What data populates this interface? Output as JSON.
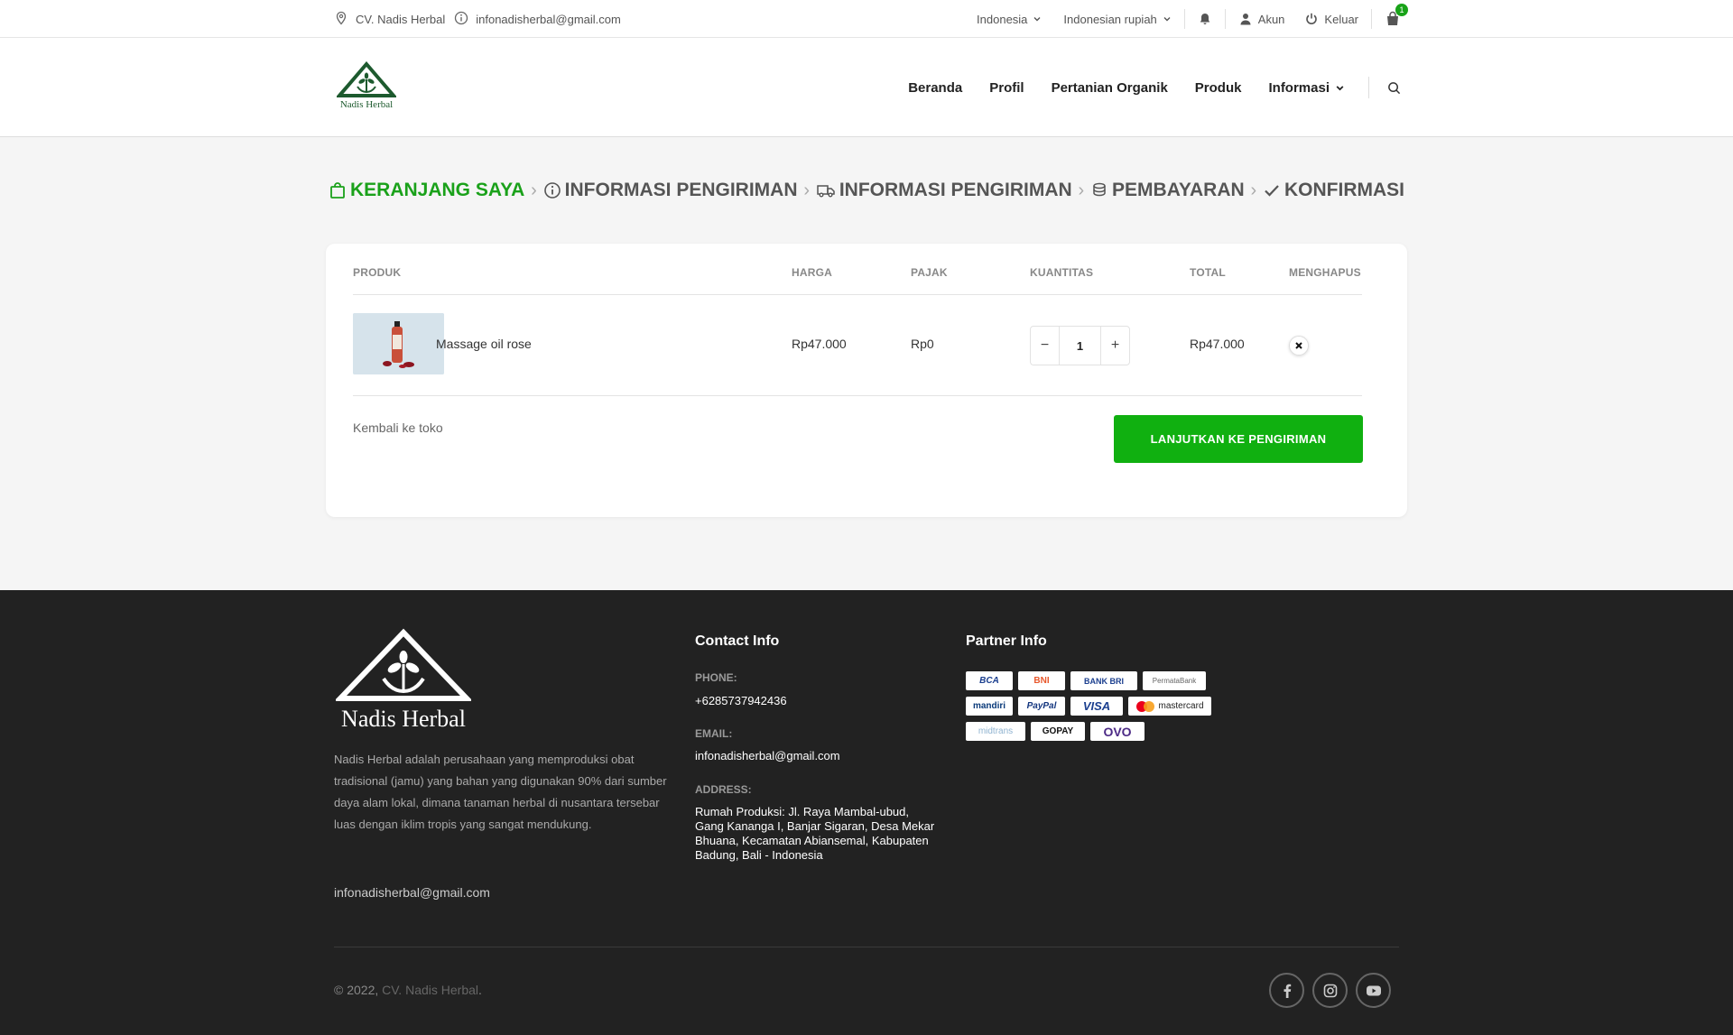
{
  "topbar": {
    "company": "CV. Nadis Herbal",
    "email": "infonadisherbal@gmail.com",
    "language": "Indonesia",
    "currency": "Indonesian rupiah",
    "account": "Akun",
    "logout": "Keluar",
    "cart_count": "1"
  },
  "header": {
    "logo_text": "Nadis Herbal",
    "nav": [
      "Beranda",
      "Profil",
      "Pertanian Organik",
      "Produk",
      "Informasi"
    ]
  },
  "steps": [
    "KERANJANG SAYA",
    "INFORMASI PENGIRIMAN",
    "INFORMASI PENGIRIMAN",
    "PEMBAYARAN",
    "KONFIRMASI"
  ],
  "cart": {
    "headers": {
      "product": "PRODUK",
      "price": "HARGA",
      "tax": "PAJAK",
      "quantity": "KUANTITAS",
      "total": "TOTAL",
      "remove": "MENGHAPUS"
    },
    "items": [
      {
        "name": "Massage oil rose",
        "price": "Rp47.000",
        "tax": "Rp0",
        "qty": "1",
        "total": "Rp47.000"
      }
    ],
    "back_link": "Kembali ke toko",
    "next_button": "LANJUTKAN KE PENGIRIMAN"
  },
  "footer": {
    "logo_text": "Nadis Herbal",
    "about": "Nadis Herbal adalah perusahaan yang memproduksi obat tradisional (jamu) yang bahan yang digunakan 90% dari sumber daya alam lokal, dimana tanaman herbal di nusantara tersebar luas dengan iklim tropis yang sangat mendukung.",
    "email": "infonadisherbal@gmail.com",
    "contact_heading": "Contact Info",
    "phone_label": "PHONE:",
    "phone": "+6285737942436",
    "email_label": "EMAIL:",
    "contact_email": "infonadisherbal@gmail.com",
    "address_label": "ADDRESS:",
    "address": "Rumah Produksi: Jl. Raya Mambal-ubud, Gang Kananga I, Banjar Sigaran, Desa Mekar Bhuana, Kecamatan Abiansemal, Kabupaten Badung, Bali - Indonesia",
    "partner_heading": "Partner Info",
    "partners": [
      [
        "BCA",
        "BNI",
        "BANK BRI",
        "PermataBank"
      ],
      [
        "mandiri",
        "PayPal",
        "VISA",
        "mastercard"
      ],
      [
        "midtrans",
        "GOPAY",
        "OVO"
      ]
    ],
    "copyright_prefix": "© 2022,",
    "copyright_brand": "CV. Nadis Herbal",
    "copyright_suffix": "."
  },
  "colors": {
    "accent_green": "#10b010",
    "step_active": "#1aa11a",
    "footer_bg": "#222222",
    "logo_green": "#1d5a2e"
  }
}
